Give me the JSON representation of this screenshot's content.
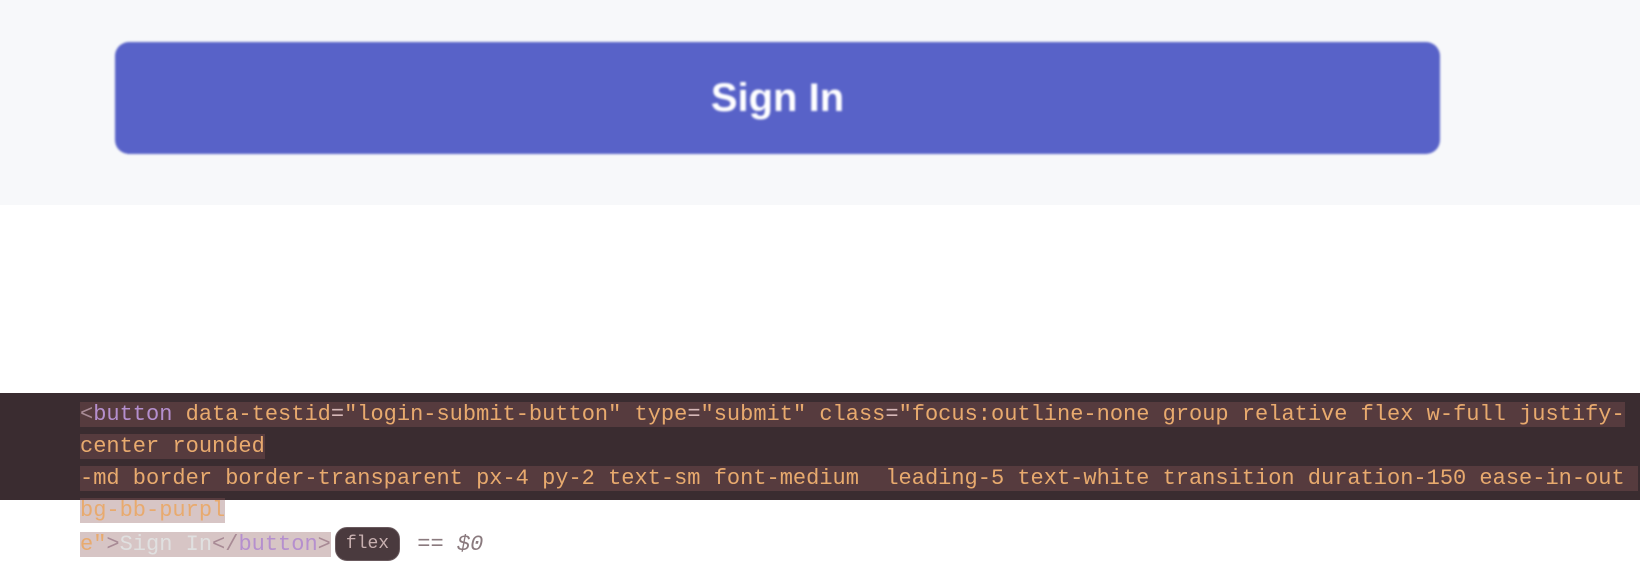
{
  "ui": {
    "signin_button_label": "Sign In"
  },
  "devtools": {
    "code": {
      "open_bracket": "<",
      "tag": "button",
      "attr1_name": "data-testid",
      "attr1_value": "\"login-submit-button\"",
      "attr2_name": "type",
      "attr2_value": "\"submit\"",
      "attr3_name": "class",
      "class_value_part1": "\"focus:outline-none group relative flex w-full justify-center rounded",
      "class_value_part2": "-md border border-transparent px-4 py-2 text-sm font-medium  leading-5 text-white transition duration-150 ease-in-out bg-bb-purpl",
      "class_value_part3": "e\"",
      "inner_text": "Sign In",
      "close_tag_open": "</",
      "close_bracket": ">",
      "eq": "=",
      "space": " "
    },
    "flex_badge": "flex",
    "eq_dollar": " == $0"
  }
}
